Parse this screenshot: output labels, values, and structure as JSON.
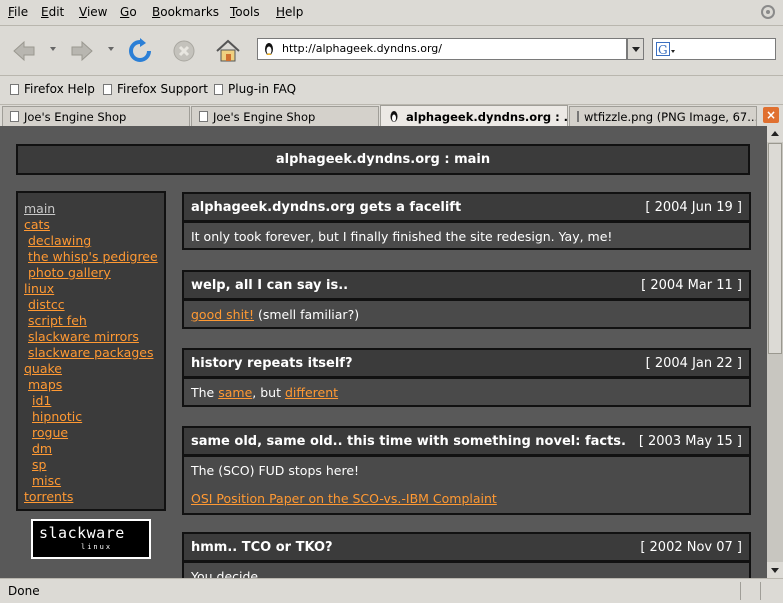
{
  "menubar": {
    "items": [
      "File",
      "Edit",
      "View",
      "Go",
      "Bookmarks",
      "Tools",
      "Help"
    ],
    "mnemonics": [
      "F",
      "E",
      "V",
      "G",
      "B",
      "T",
      "H"
    ]
  },
  "navbar": {
    "url": "http://alphageek.dyndns.org/",
    "buttons": [
      "back-icon",
      "forward-icon",
      "reload-icon",
      "stop-icon",
      "home-icon"
    ]
  },
  "bookmarks": {
    "items": [
      "Firefox Help",
      "Firefox Support",
      "Plug-in FAQ"
    ]
  },
  "tabs": [
    {
      "label": "Joe's Engine Shop",
      "active": false
    },
    {
      "label": "Joe's Engine Shop",
      "active": false
    },
    {
      "label": "alphageek.dyndns.org : ...",
      "active": true
    },
    {
      "label": "wtfizzle.png (PNG Image, 67...",
      "active": false
    }
  ],
  "page": {
    "title": "alphageek.dyndns.org : main",
    "nav": [
      "main",
      "cats",
      "declawing",
      "the whisp's pedigree",
      "photo gallery",
      "linux",
      "distcc",
      "script feh",
      "slackware mirrors",
      "slackware packages",
      "quake",
      "maps",
      "id1",
      "hipnotic",
      "rogue",
      "dm",
      "sp",
      "misc",
      "torrents"
    ],
    "logo_main": "slackware",
    "logo_sub": "linux",
    "posts": [
      {
        "title": "alphageek.dyndns.org gets a facelift",
        "date": "[ 2004 Jun 19 ]",
        "body": "It only took forever, but I finally finished the site redesign. Yay, me!"
      },
      {
        "title": "welp, all I can say is..",
        "date": "[ 2004 Mar 11 ]",
        "link": "good shit!",
        "rest": " (smell familiar?)"
      },
      {
        "title": "history repeats itself?",
        "date": "[ 2004 Jan 22 ]",
        "pre": "The ",
        "link1": "same",
        "mid": ", but ",
        "link2": "different"
      },
      {
        "title": "same old, same old.. this time with something novel: facts.",
        "date": "[ 2003 May 15 ]",
        "body": "The (SCO) FUD stops here!",
        "link": "OSI Position Paper on the SCO-vs.-IBM Complaint"
      },
      {
        "title": "hmm.. TCO or TKO?",
        "date": "[ 2002 Nov 07 ]",
        "body": "You decide"
      }
    ]
  },
  "status": {
    "text": "Done"
  },
  "colors": {
    "link": "#ff9933",
    "content_bg": "#595959",
    "box_bg": "#3b3b3b",
    "tab_close": "#e07030"
  }
}
